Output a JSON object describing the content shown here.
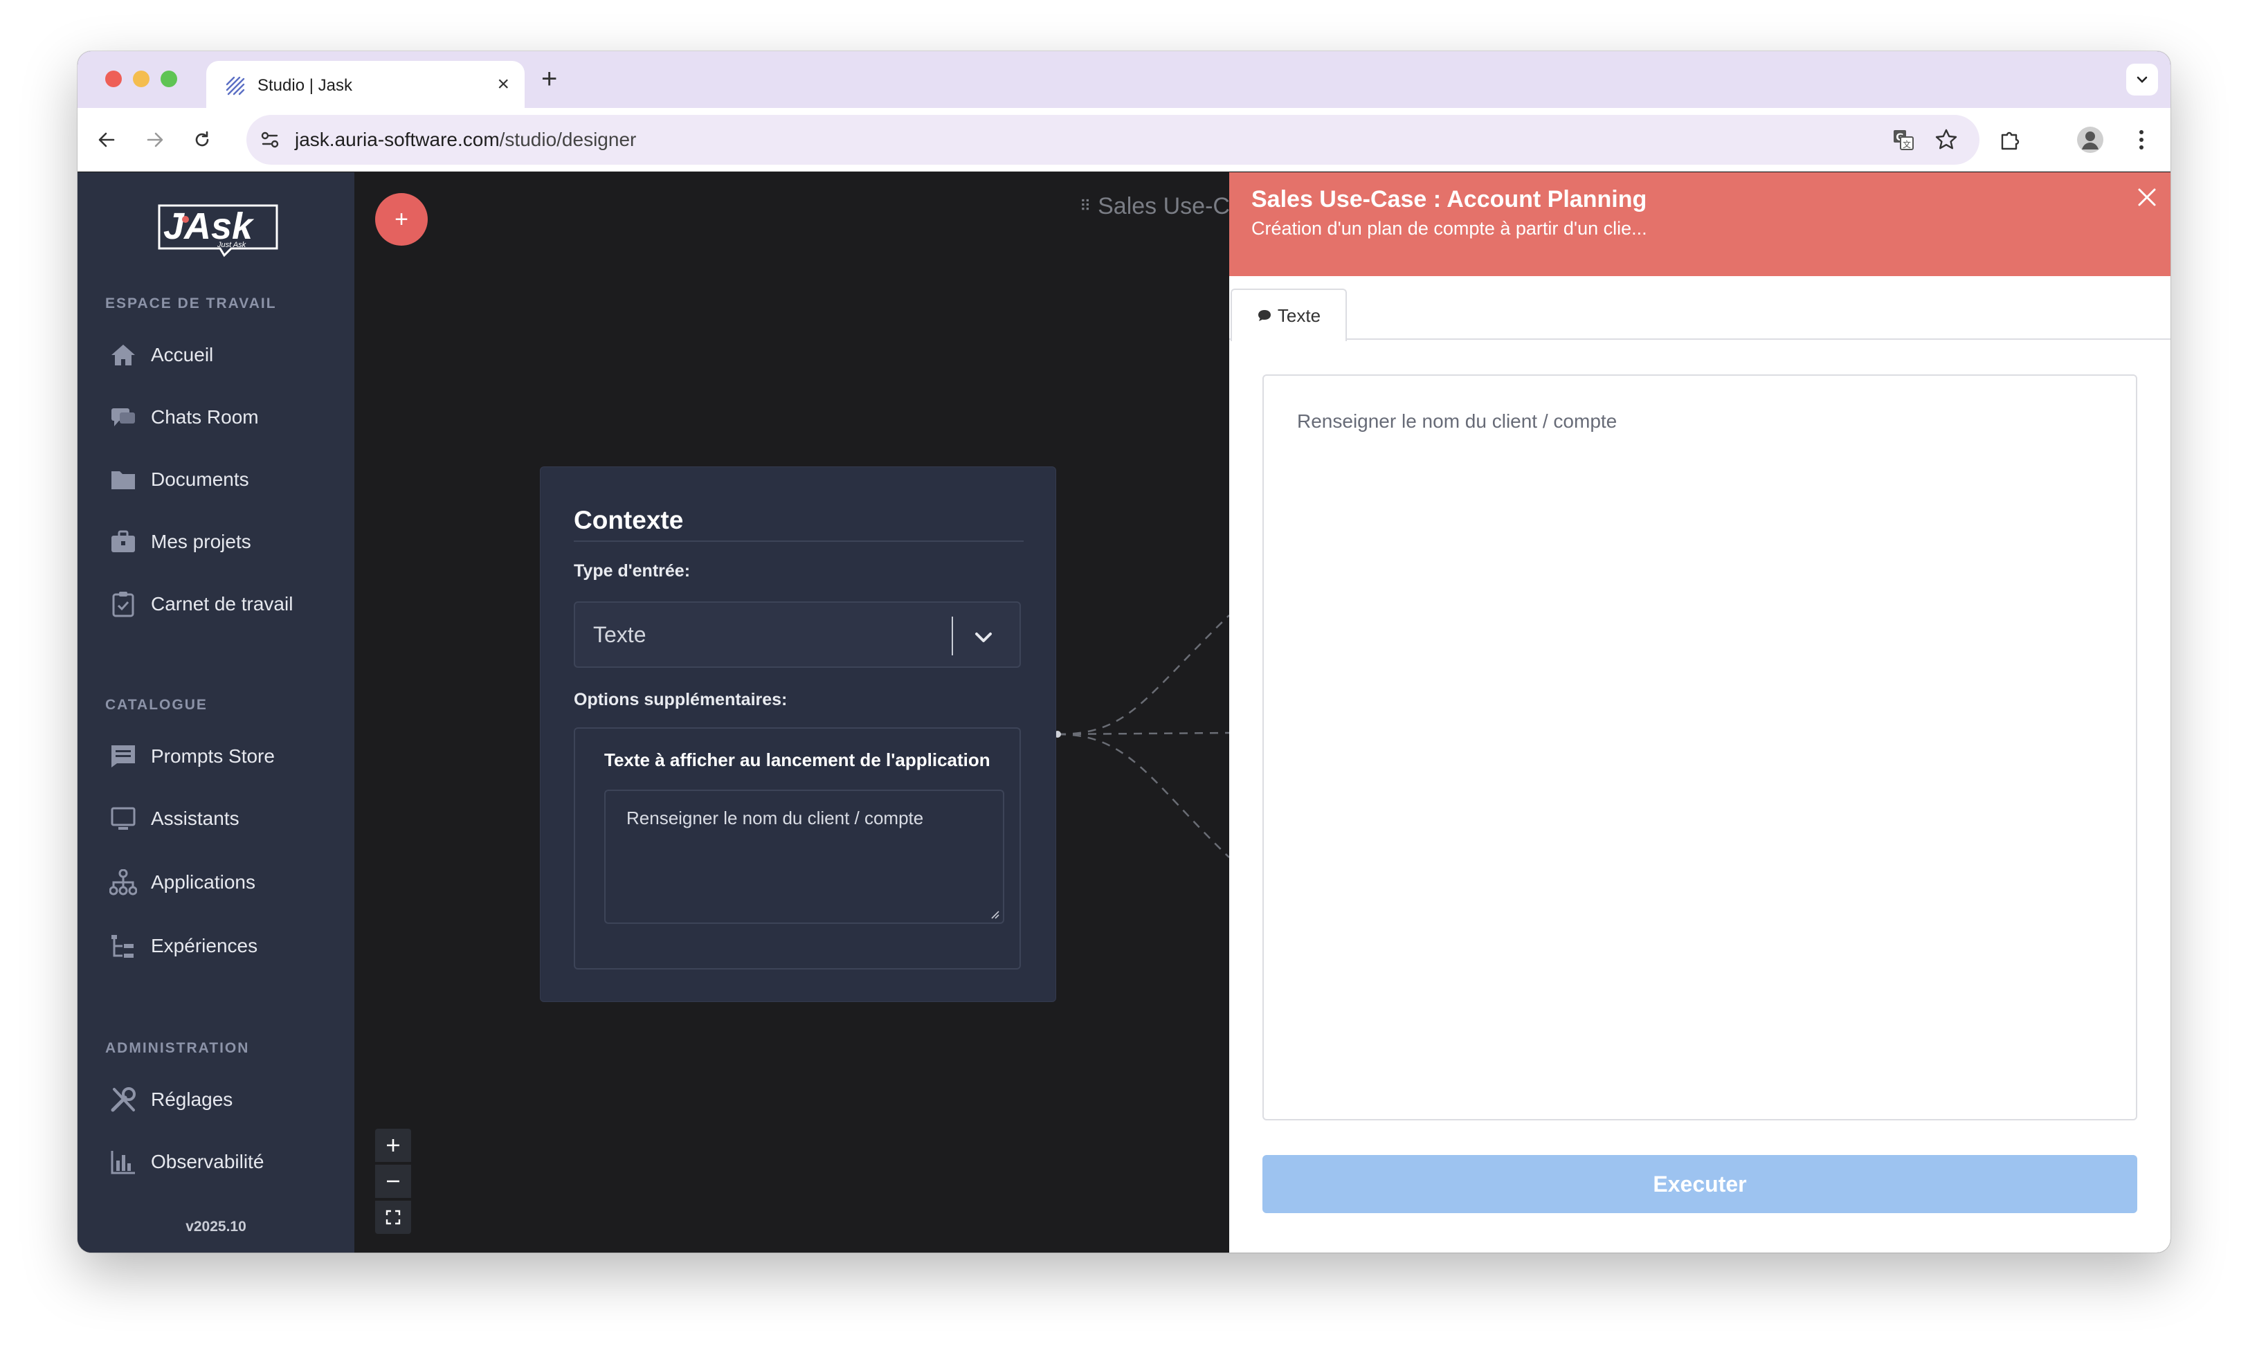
{
  "browser": {
    "tab_title": "Studio | Jask",
    "url_host": "jask.auria-software.com",
    "url_path": "/studio/designer"
  },
  "sidebar": {
    "logo_text": "JAsk",
    "logo_tagline": "Just Ask",
    "sections": {
      "workspace": "ESPACE DE TRAVAIL",
      "catalog": "CATALOGUE",
      "admin": "ADMINISTRATION"
    },
    "items": [
      {
        "label": "Accueil",
        "icon": "home-icon"
      },
      {
        "label": "Chats Room",
        "icon": "chat-icon"
      },
      {
        "label": "Documents",
        "icon": "folder-icon"
      },
      {
        "label": "Mes projets",
        "icon": "briefcase-icon"
      },
      {
        "label": "Carnet de travail",
        "icon": "clipboard-check-icon"
      },
      {
        "label": "Prompts Store",
        "icon": "message-icon"
      },
      {
        "label": "Assistants",
        "icon": "monitor-icon"
      },
      {
        "label": "Applications",
        "icon": "sitemap-icon"
      },
      {
        "label": "Expériences",
        "icon": "tree-icon"
      },
      {
        "label": "Réglages",
        "icon": "tools-icon"
      },
      {
        "label": "Observabilité",
        "icon": "bar-chart-icon"
      }
    ],
    "version": "v2025.10"
  },
  "canvas": {
    "add_label": "+",
    "title": "Sales Use-C",
    "node": {
      "title": "Contexte",
      "input_type_label": "Type d'entrée:",
      "input_type_value": "Texte",
      "options_label": "Options supplémentaires:",
      "launch_text_label": "Texte à afficher au lancement de l'application",
      "launch_text_value": "Renseigner le nom du client / compte"
    },
    "zoom": {
      "in": "+",
      "out": "−"
    }
  },
  "panel": {
    "title": "Sales Use-Case : Account Planning",
    "subtitle": "Création d'un plan de compte à partir d'un clie...",
    "tab_label": "Texte",
    "textarea_placeholder": "Renseigner le nom du client / compte",
    "execute_label": "Executer"
  },
  "colors": {
    "accent": "#e4726a",
    "sidebar_bg": "#2b3142",
    "execute_disabled": "#9dc3f0"
  }
}
